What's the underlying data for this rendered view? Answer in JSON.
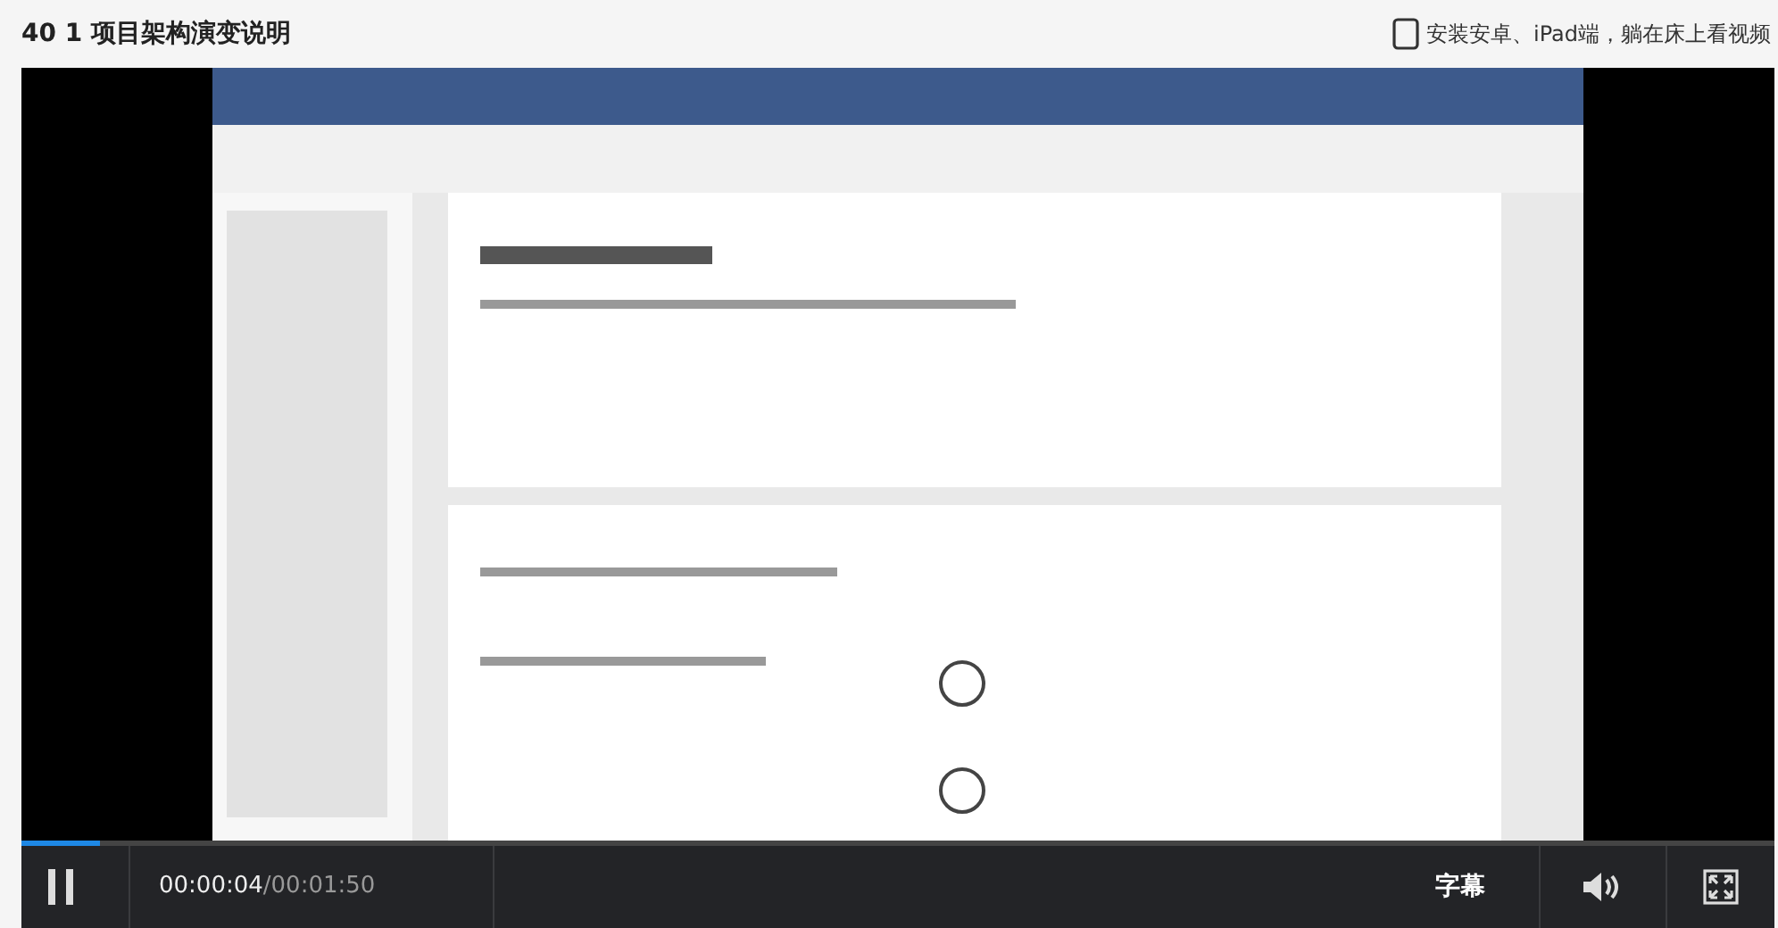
{
  "page": {
    "title": "40 1 项目架构演变说明",
    "app_promo": "安装安卓、iPad端，躺在床上看视频"
  },
  "player": {
    "progress": {
      "level": 0.045
    },
    "playing": true,
    "current_time": "00:00:04",
    "duration": "/00:01:50",
    "subtitles_button": "字幕"
  }
}
